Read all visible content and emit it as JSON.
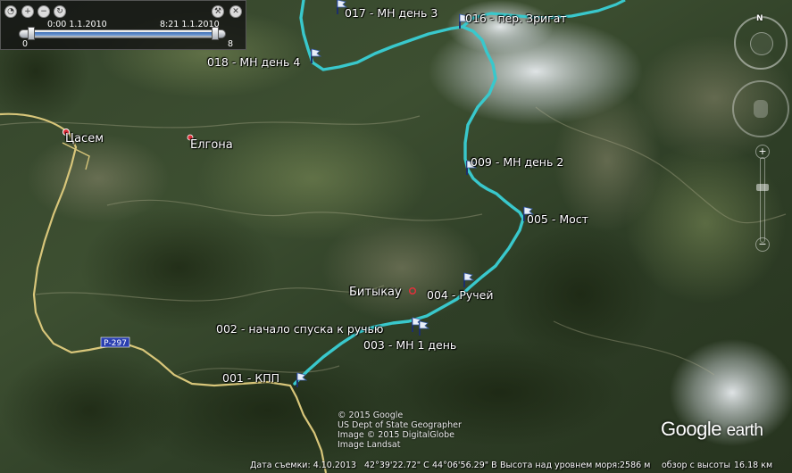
{
  "time_slider": {
    "start_time": "0:00 1.1.2010",
    "end_time": "8:21 1.1.2010",
    "scale_min": "0",
    "scale_max": "8",
    "range_fraction": 1.0
  },
  "route": {
    "color": "#39c8cc",
    "waypoints": [
      {
        "label": "001 - КПП"
      },
      {
        "label": "002 - начало спуска к ручью"
      },
      {
        "label": "003 - МН 1 день"
      },
      {
        "label": "004 - Ручей"
      },
      {
        "label": "005 - Мост"
      },
      {
        "label": "009 - МН день 2"
      },
      {
        "label": "016 - пер. Зригат"
      },
      {
        "label": "017 - МН день 3"
      },
      {
        "label": "018 - МН день 4"
      }
    ]
  },
  "places": [
    {
      "name": "Цасем"
    },
    {
      "name": "Елгона"
    },
    {
      "name": "Битыкау"
    }
  ],
  "road_badge": "Р-297",
  "copyright": [
    "© 2015 Google",
    "US Dept of State Geographer",
    "Image © 2015 DigitalGlobe",
    "Image Landsat"
  ],
  "status": {
    "date_label": "Дата съемки: 4.10.2013",
    "latitude": "42°39'22.72\" С",
    "longitude": "44°06'56.29\" В",
    "elevation_label": "Высота над уровнем моря:",
    "elevation_value": "2586 м",
    "eye_label": "обзор с высоты",
    "eye_value": "16.18 км"
  },
  "logo": {
    "google": "Google",
    "earth": "earth"
  },
  "nav": {
    "north": "N"
  }
}
